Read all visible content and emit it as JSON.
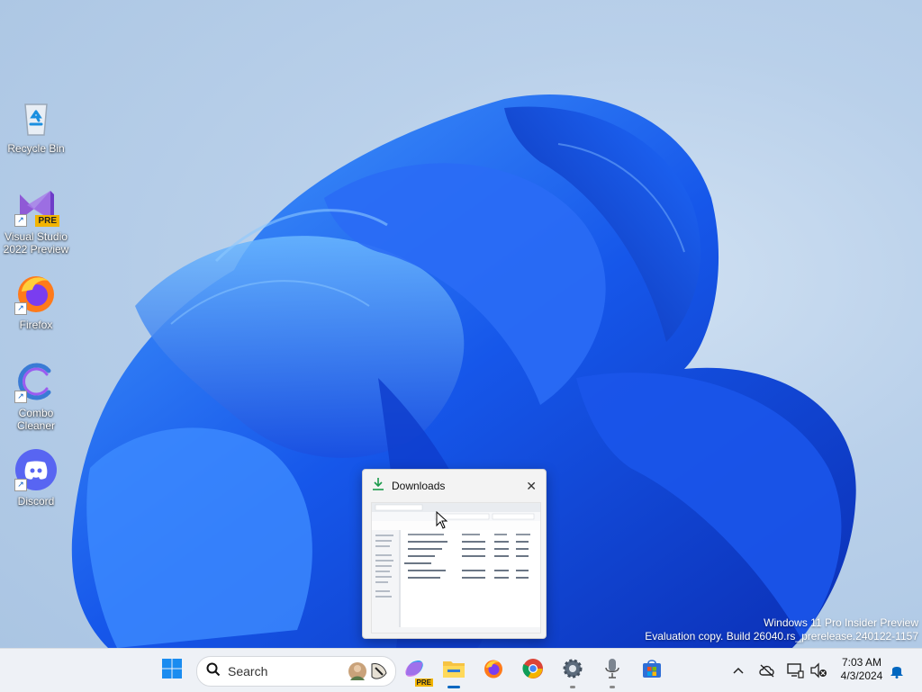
{
  "desktop": {
    "icons": [
      {
        "label": "Recycle Bin",
        "icon": "recycle-bin-icon"
      },
      {
        "label": "Visual Studio 2022 Preview",
        "badge": "PRE",
        "icon": "visual-studio-icon"
      },
      {
        "label": "Firefox",
        "icon": "firefox-icon"
      },
      {
        "label": "Combo Cleaner",
        "icon": "combo-cleaner-icon"
      },
      {
        "label": "Discord",
        "icon": "discord-icon"
      }
    ]
  },
  "watermark": {
    "line1": "Windows 11 Pro Insider Preview",
    "line2": "Evaluation copy. Build 26040.rs_prerelease.240122-1157"
  },
  "thumbnail": {
    "title": "Downloads",
    "close_glyph": "✕"
  },
  "taskbar": {
    "search_placeholder": "Search",
    "apps": [
      {
        "name": "start",
        "icon": "windows-start-icon"
      },
      {
        "name": "copilot",
        "icon": "copilot-icon",
        "badge": "PRE"
      },
      {
        "name": "file-explorer",
        "icon": "file-explorer-icon"
      },
      {
        "name": "firefox",
        "icon": "firefox-icon"
      },
      {
        "name": "chrome",
        "icon": "chrome-icon"
      },
      {
        "name": "settings",
        "icon": "settings-gear-icon"
      },
      {
        "name": "microphone",
        "icon": "microphone-icon"
      },
      {
        "name": "store",
        "icon": "microsoft-store-icon"
      }
    ],
    "tray": {
      "time": "7:03 AM",
      "date": "4/3/2024"
    }
  },
  "colors": {
    "accent": "#0067c0",
    "wallpaper_blue": "#1a5cf0",
    "taskbar_bg": "#eef1f6"
  }
}
